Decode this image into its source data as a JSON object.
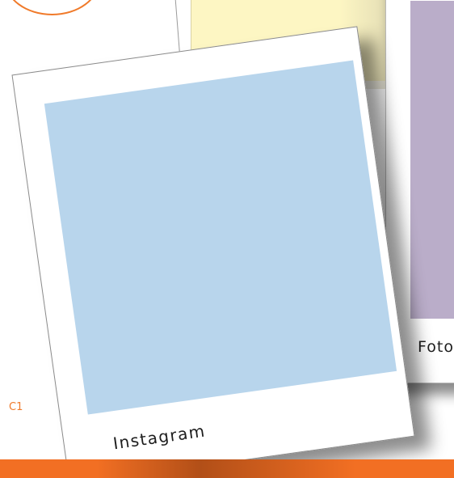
{
  "page": {
    "code": "C1"
  },
  "polaroids": {
    "main": {
      "caption": "Instagram",
      "photo_color": "#b8d5ec"
    },
    "right": {
      "caption": "Foto",
      "photo_color": "#baadc9"
    }
  },
  "colors": {
    "accent": "#f26f23",
    "note": "#fdf6c3"
  }
}
